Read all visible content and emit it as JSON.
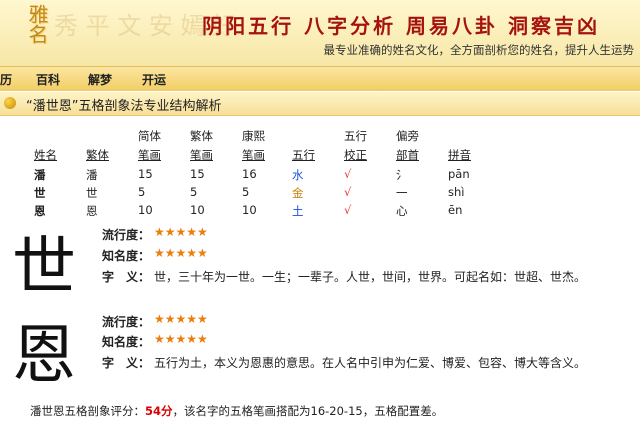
{
  "header": {
    "logo_text": "雅名",
    "deco_text": "秀 平 文 安 嫣 好",
    "slogan": "阴阳五行 八字分析 周易八卦 洞察吉凶",
    "subtitle": "最专业准确的姓名文化，全方面剖析您的姓名，提升人生运势"
  },
  "nav": [
    "历",
    "百科",
    "解梦",
    "开运"
  ],
  "section_title": "“潘世恩”五格剖象法专业结构解析",
  "table": {
    "headers_top": {
      "jianti": "简体",
      "fanti": "繁体",
      "kangxi": "康熙",
      "wuxing": "五行",
      "pianpang": "偏旁"
    },
    "headers": {
      "name": "姓名",
      "fanti": "繁体",
      "jianti": "笔画",
      "fanti_strokes": "笔画",
      "kangxi_strokes": "笔画",
      "wuxing": "五行",
      "jiaozheng": "校正",
      "bushou": "部首",
      "pinyin": "拼音"
    },
    "jiaozheng_top": "五行",
    "pianpang_top": "偏旁",
    "rows": [
      {
        "name": "潘",
        "fanti": "潘",
        "jianti": "15",
        "fanti_s": "15",
        "kangxi": "16",
        "wuxing": "水",
        "check": "√",
        "bushou": "氵",
        "pinyin": "pān"
      },
      {
        "name": "世",
        "fanti": "世",
        "jianti": "5",
        "fanti_s": "5",
        "kangxi": "5",
        "wuxing": "金",
        "check": "√",
        "bushou": "一",
        "pinyin": "shì"
      },
      {
        "name": "恩",
        "fanti": "恩",
        "jianti": "10",
        "fanti_s": "10",
        "kangxi": "10",
        "wuxing": "土",
        "check": "√",
        "bushou": "心",
        "pinyin": "ēn"
      }
    ]
  },
  "chars": [
    {
      "char": "世",
      "popularity_label": "流行度：",
      "popularity_stars": "★★★★★",
      "fame_label": "知名度：",
      "fame_stars": "★★★★★",
      "meaning_label": "字　义：",
      "meaning": "世，三十年为一世。一生；一辈子。人世，世间，世界。可起名如：世超、世杰。"
    },
    {
      "char": "恩",
      "popularity_label": "流行度：",
      "popularity_stars": "★★★★★",
      "fame_label": "知名度：",
      "fame_stars": "★★★★★",
      "meaning_label": "字　义：",
      "meaning": "五行为土，本义为恩惠的意思。在人名中引申为仁爱、博爱、包容、博大等含义。"
    }
  ],
  "score": {
    "prefix": "潘世恩五格剖象评分：",
    "value": "54分",
    "suffix": "，该名字的五格笔画搭配为16-20-15，五格配置差。"
  },
  "colors": {
    "brand_red": "#a6120e",
    "star_orange": "#ea7d0b",
    "nav_gold": "#f2cd63"
  }
}
